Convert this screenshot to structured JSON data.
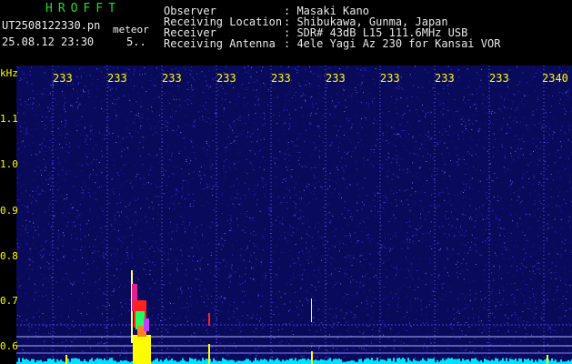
{
  "header": {
    "brand": "HROFFT",
    "filename": "UT2508122330.pn",
    "mode": "meteor",
    "datetime": "25.08.12 23:30",
    "counter": "5..",
    "labels": [
      {
        "k": "Observer",
        "v": ": Masaki Kano"
      },
      {
        "k": "Receiving Location",
        "v": ": Shibukawa, Gunma, Japan"
      },
      {
        "k": "Receiver",
        "v": ": SDR# 43dB L15 111.6MHz USB"
      },
      {
        "k": "Receiving Antenna",
        "v": ": 4ele Yagi Az 230 for Kansai VOR"
      }
    ]
  },
  "plot": {
    "yunit": "kHz",
    "ytick_labels": [
      "1.1",
      "1.0",
      "0.9",
      "0.8",
      "0.7",
      "0.6"
    ],
    "xtick_labels": [
      "233",
      "233",
      "233",
      "233",
      "233",
      "233",
      "233",
      "233",
      "233",
      "2340"
    ],
    "colors": {
      "background": "#0a0a5a",
      "noise": "#3a3aff",
      "signal": "#ffff00",
      "hot": "#ff2020",
      "cyan": "#00e0ff"
    }
  }
}
